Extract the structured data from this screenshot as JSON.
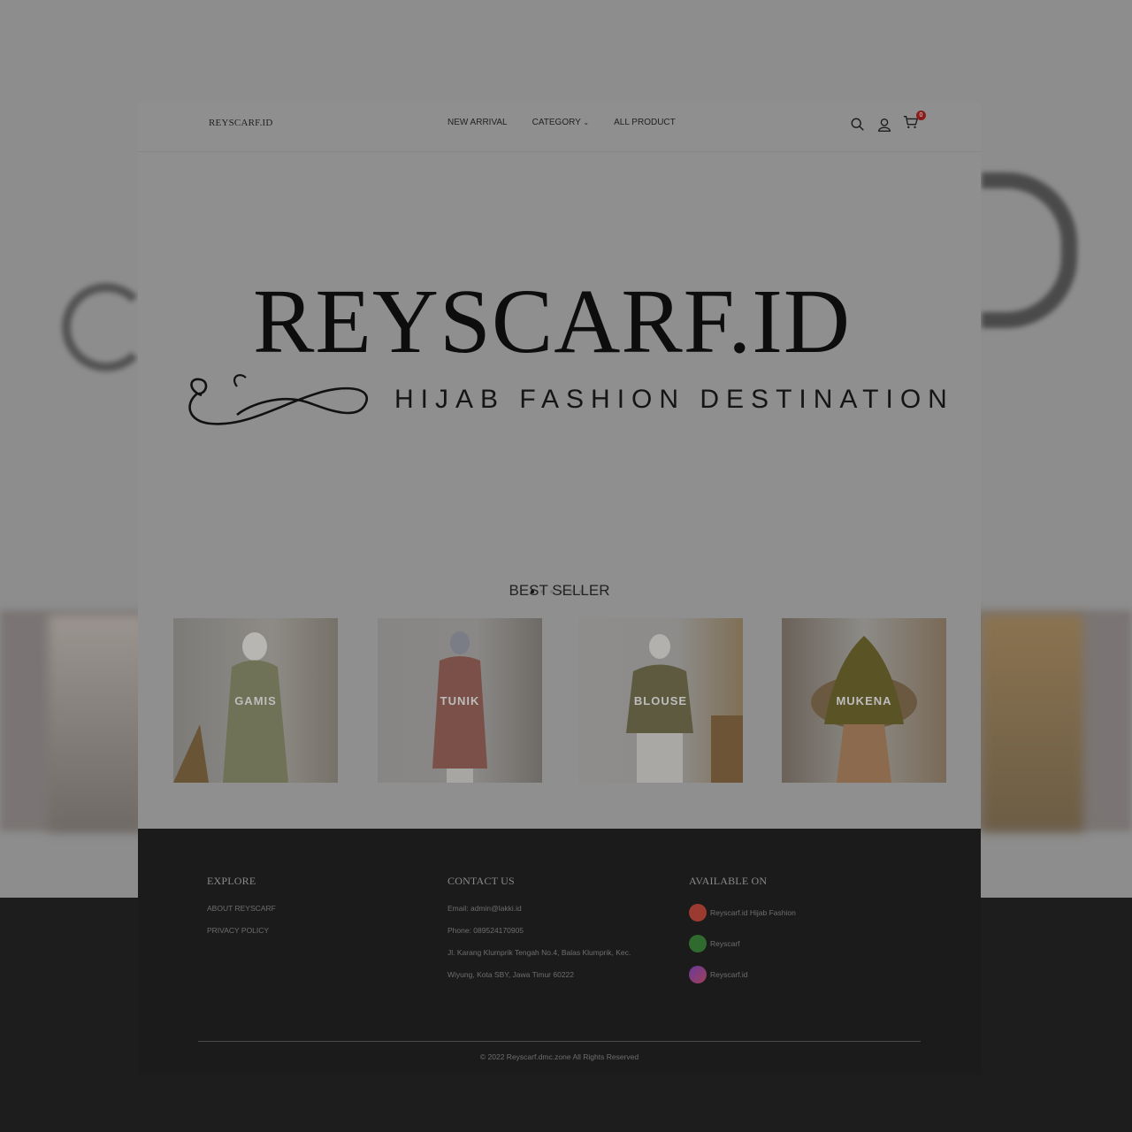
{
  "header": {
    "logo": "REYSCARF.ID",
    "nav": [
      "NEW ARRIVAL",
      "CATEGORY",
      "ALL PRODUCT"
    ],
    "cart_count": "0",
    "icons": [
      "search-icon",
      "user-icon",
      "cart-icon"
    ]
  },
  "hero": {
    "title": "REYSCARF.ID",
    "subtitle": "HIJAB FASHION DESTINATION",
    "slides": 6,
    "active_slide": 1
  },
  "best_seller": {
    "title": "BEST SELLER",
    "products": [
      {
        "label": "GAMIS"
      },
      {
        "label": "TUNIK"
      },
      {
        "label": "BLOUSE"
      },
      {
        "label": "MUKENA"
      }
    ]
  },
  "footer": {
    "explore": {
      "title": "EXPLORE",
      "links": [
        "ABOUT REYSCARF",
        "PRIVACY POLICY"
      ]
    },
    "contact": {
      "title": "CONTACT US",
      "email": "Email: admin@lakki.id",
      "phone": "Phone: 089524170905",
      "address1": "Jl. Karang Klumprik Tengah No.4, Balas Klumprik, Kec.",
      "address2": "Wiyung, Kota SBY, Jawa Timur 60222"
    },
    "available": {
      "title": "AVAILABLE ON",
      "items": [
        {
          "label": "Reyscarf.id Hijab Fashion",
          "color": "#c0392b"
        },
        {
          "label": "Reyscarf",
          "color": "#2f7a2f"
        },
        {
          "label": "Reyscarf.id",
          "color": "#7b3fa0"
        }
      ]
    },
    "copyright": "© 2022 Reyscarf.dmc.zone All Rights Reserved"
  }
}
